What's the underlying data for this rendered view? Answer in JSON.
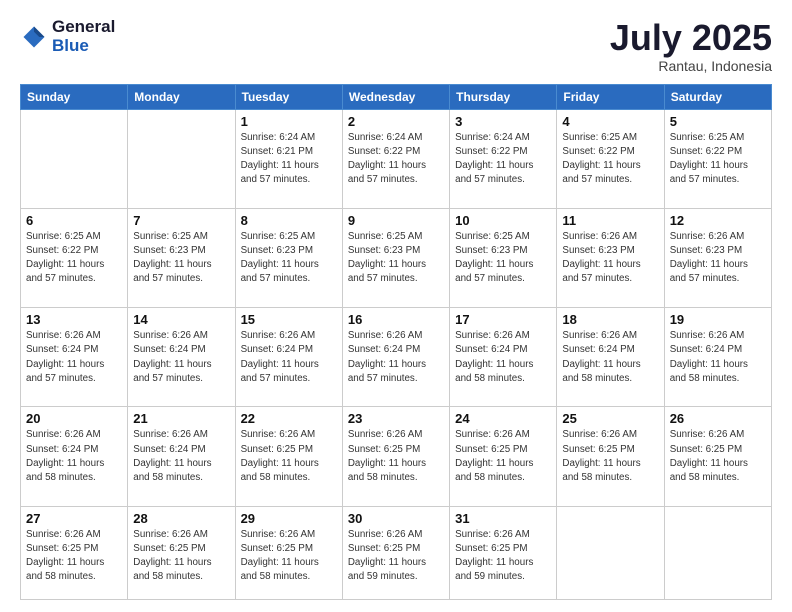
{
  "header": {
    "logo_general": "General",
    "logo_blue": "Blue",
    "month": "July 2025",
    "location": "Rantau, Indonesia"
  },
  "weekdays": [
    "Sunday",
    "Monday",
    "Tuesday",
    "Wednesday",
    "Thursday",
    "Friday",
    "Saturday"
  ],
  "weeks": [
    [
      {
        "day": "",
        "info": ""
      },
      {
        "day": "",
        "info": ""
      },
      {
        "day": "1",
        "info": "Sunrise: 6:24 AM\nSunset: 6:21 PM\nDaylight: 11 hours and 57 minutes."
      },
      {
        "day": "2",
        "info": "Sunrise: 6:24 AM\nSunset: 6:22 PM\nDaylight: 11 hours and 57 minutes."
      },
      {
        "day": "3",
        "info": "Sunrise: 6:24 AM\nSunset: 6:22 PM\nDaylight: 11 hours and 57 minutes."
      },
      {
        "day": "4",
        "info": "Sunrise: 6:25 AM\nSunset: 6:22 PM\nDaylight: 11 hours and 57 minutes."
      },
      {
        "day": "5",
        "info": "Sunrise: 6:25 AM\nSunset: 6:22 PM\nDaylight: 11 hours and 57 minutes."
      }
    ],
    [
      {
        "day": "6",
        "info": "Sunrise: 6:25 AM\nSunset: 6:22 PM\nDaylight: 11 hours and 57 minutes."
      },
      {
        "day": "7",
        "info": "Sunrise: 6:25 AM\nSunset: 6:23 PM\nDaylight: 11 hours and 57 minutes."
      },
      {
        "day": "8",
        "info": "Sunrise: 6:25 AM\nSunset: 6:23 PM\nDaylight: 11 hours and 57 minutes."
      },
      {
        "day": "9",
        "info": "Sunrise: 6:25 AM\nSunset: 6:23 PM\nDaylight: 11 hours and 57 minutes."
      },
      {
        "day": "10",
        "info": "Sunrise: 6:25 AM\nSunset: 6:23 PM\nDaylight: 11 hours and 57 minutes."
      },
      {
        "day": "11",
        "info": "Sunrise: 6:26 AM\nSunset: 6:23 PM\nDaylight: 11 hours and 57 minutes."
      },
      {
        "day": "12",
        "info": "Sunrise: 6:26 AM\nSunset: 6:23 PM\nDaylight: 11 hours and 57 minutes."
      }
    ],
    [
      {
        "day": "13",
        "info": "Sunrise: 6:26 AM\nSunset: 6:24 PM\nDaylight: 11 hours and 57 minutes."
      },
      {
        "day": "14",
        "info": "Sunrise: 6:26 AM\nSunset: 6:24 PM\nDaylight: 11 hours and 57 minutes."
      },
      {
        "day": "15",
        "info": "Sunrise: 6:26 AM\nSunset: 6:24 PM\nDaylight: 11 hours and 57 minutes."
      },
      {
        "day": "16",
        "info": "Sunrise: 6:26 AM\nSunset: 6:24 PM\nDaylight: 11 hours and 57 minutes."
      },
      {
        "day": "17",
        "info": "Sunrise: 6:26 AM\nSunset: 6:24 PM\nDaylight: 11 hours and 58 minutes."
      },
      {
        "day": "18",
        "info": "Sunrise: 6:26 AM\nSunset: 6:24 PM\nDaylight: 11 hours and 58 minutes."
      },
      {
        "day": "19",
        "info": "Sunrise: 6:26 AM\nSunset: 6:24 PM\nDaylight: 11 hours and 58 minutes."
      }
    ],
    [
      {
        "day": "20",
        "info": "Sunrise: 6:26 AM\nSunset: 6:24 PM\nDaylight: 11 hours and 58 minutes."
      },
      {
        "day": "21",
        "info": "Sunrise: 6:26 AM\nSunset: 6:24 PM\nDaylight: 11 hours and 58 minutes."
      },
      {
        "day": "22",
        "info": "Sunrise: 6:26 AM\nSunset: 6:25 PM\nDaylight: 11 hours and 58 minutes."
      },
      {
        "day": "23",
        "info": "Sunrise: 6:26 AM\nSunset: 6:25 PM\nDaylight: 11 hours and 58 minutes."
      },
      {
        "day": "24",
        "info": "Sunrise: 6:26 AM\nSunset: 6:25 PM\nDaylight: 11 hours and 58 minutes."
      },
      {
        "day": "25",
        "info": "Sunrise: 6:26 AM\nSunset: 6:25 PM\nDaylight: 11 hours and 58 minutes."
      },
      {
        "day": "26",
        "info": "Sunrise: 6:26 AM\nSunset: 6:25 PM\nDaylight: 11 hours and 58 minutes."
      }
    ],
    [
      {
        "day": "27",
        "info": "Sunrise: 6:26 AM\nSunset: 6:25 PM\nDaylight: 11 hours and 58 minutes."
      },
      {
        "day": "28",
        "info": "Sunrise: 6:26 AM\nSunset: 6:25 PM\nDaylight: 11 hours and 58 minutes."
      },
      {
        "day": "29",
        "info": "Sunrise: 6:26 AM\nSunset: 6:25 PM\nDaylight: 11 hours and 58 minutes."
      },
      {
        "day": "30",
        "info": "Sunrise: 6:26 AM\nSunset: 6:25 PM\nDaylight: 11 hours and 59 minutes."
      },
      {
        "day": "31",
        "info": "Sunrise: 6:26 AM\nSunset: 6:25 PM\nDaylight: 11 hours and 59 minutes."
      },
      {
        "day": "",
        "info": ""
      },
      {
        "day": "",
        "info": ""
      }
    ]
  ]
}
